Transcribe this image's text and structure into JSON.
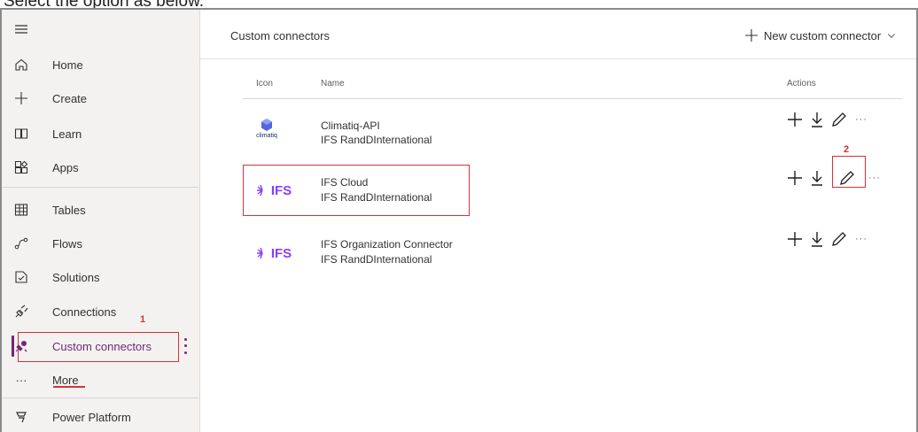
{
  "caption": "Select the option as below.",
  "sidebar": {
    "items": [
      {
        "label": "Home",
        "icon": "home-icon"
      },
      {
        "label": "Create",
        "icon": "plus-icon"
      },
      {
        "label": "Learn",
        "icon": "book-icon"
      },
      {
        "label": "Apps",
        "icon": "apps-icon"
      },
      {
        "label": "Tables",
        "icon": "table-icon"
      },
      {
        "label": "Flows",
        "icon": "flow-icon"
      },
      {
        "label": "Solutions",
        "icon": "solutions-icon"
      },
      {
        "label": "Connections",
        "icon": "plug-icon"
      },
      {
        "label": "Custom connectors",
        "icon": "custom-connector-icon"
      },
      {
        "label": "More",
        "icon": "ellipsis-icon"
      },
      {
        "label": "Power Platform",
        "icon": "power-platform-icon"
      }
    ]
  },
  "markers": {
    "step1": "1",
    "step2": "2"
  },
  "header": {
    "title": "Custom connectors",
    "new_button": "New custom connector"
  },
  "table": {
    "columns": [
      "Icon",
      "Name",
      "Actions"
    ],
    "rows": [
      {
        "name": "Climatiq-API",
        "owner": "IFS RandDInternational",
        "logo_text": "climatiq"
      },
      {
        "name": "IFS Cloud",
        "owner": "IFS RandDInternational",
        "logo_text": "IFS"
      },
      {
        "name": "IFS Organization Connector",
        "owner": "IFS RandDInternational",
        "logo_text": "IFS"
      }
    ],
    "more_actions": "···"
  },
  "colors": {
    "accent": "#742774",
    "highlight": "#d13438",
    "ifs_purple": "#8a3ffc"
  }
}
